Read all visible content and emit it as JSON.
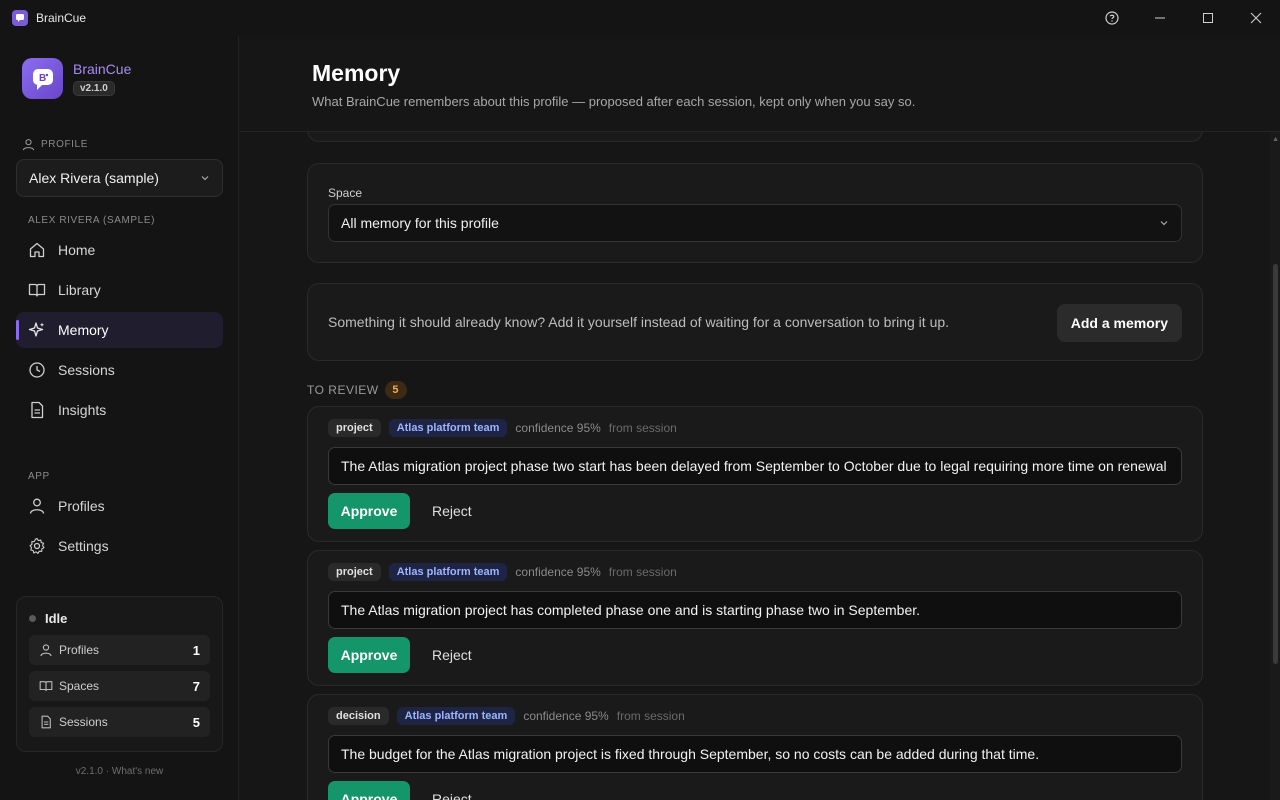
{
  "window": {
    "title": "BrainCue"
  },
  "brand": {
    "name": "BrainCue",
    "version": "v2.1.0"
  },
  "sidebar": {
    "profile_section": "PROFILE",
    "profile_selected": "Alex Rivera (sample)",
    "profile_group": "ALEX RIVERA (SAMPLE)",
    "nav": [
      {
        "label": "Home",
        "icon": "home-icon"
      },
      {
        "label": "Library",
        "icon": "book-icon"
      },
      {
        "label": "Memory",
        "icon": "sparkle-icon",
        "active": true
      },
      {
        "label": "Sessions",
        "icon": "clock-icon"
      },
      {
        "label": "Insights",
        "icon": "document-icon"
      }
    ],
    "app_section": "APP",
    "app_nav": [
      {
        "label": "Profiles",
        "icon": "user-icon"
      },
      {
        "label": "Settings",
        "icon": "gear-icon"
      }
    ],
    "status": {
      "state": "Idle",
      "stats": [
        {
          "label": "Profiles",
          "value": "1"
        },
        {
          "label": "Spaces",
          "value": "7"
        },
        {
          "label": "Sessions",
          "value": "5"
        }
      ]
    },
    "footer": "v2.1.0 · What's new"
  },
  "main": {
    "title": "Memory",
    "subtitle": "What BrainCue remembers about this profile — proposed after each session, kept only when you say so.",
    "space_label": "Space",
    "space_value": "All memory for this profile",
    "add_prompt": "Something it should already know? Add it yourself instead of waiting for a conversation to bring it up.",
    "add_button": "Add a memory",
    "review_label": "TO REVIEW",
    "review_count": "5",
    "memories": [
      {
        "kind": "project",
        "space": "Atlas platform team",
        "confidence": "confidence 95%",
        "source": "from session",
        "text": "The Atlas migration project phase two start has been delayed from September to October due to legal requiring more time on renewal",
        "approve": "Approve",
        "reject": "Reject"
      },
      {
        "kind": "project",
        "space": "Atlas platform team",
        "confidence": "confidence 95%",
        "source": "from session",
        "text": "The Atlas migration project has completed phase one and is starting phase two in September.",
        "approve": "Approve",
        "reject": "Reject"
      },
      {
        "kind": "decision",
        "space": "Atlas platform team",
        "confidence": "confidence 95%",
        "source": "from session",
        "text": "The budget for the Atlas migration project is fixed through September, so no costs can be added during that time.",
        "approve": "Approve",
        "reject": "Reject"
      }
    ]
  },
  "colors": {
    "accent": "#8b6cf0",
    "approve": "#14966a",
    "space_tag": "#9db4ff",
    "review_badge": "#f0a955"
  }
}
